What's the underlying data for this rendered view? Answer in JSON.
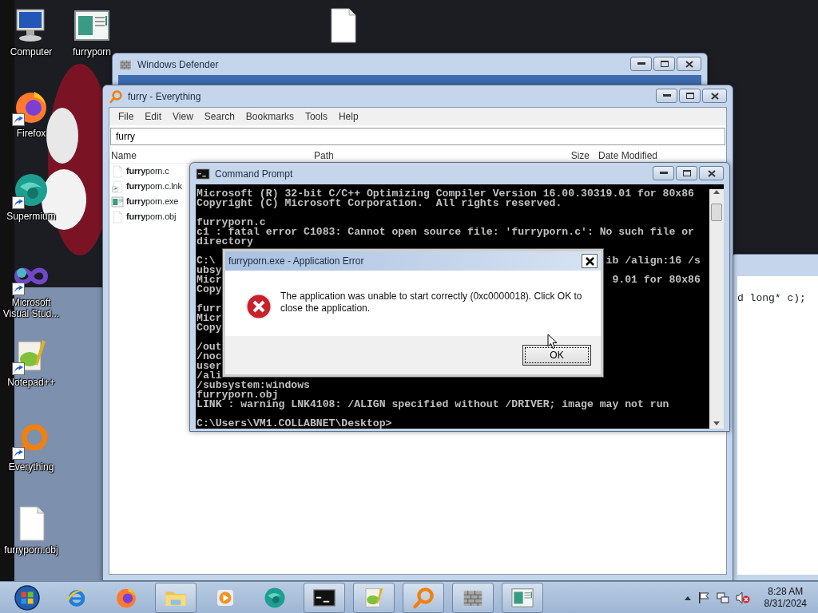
{
  "desktop_icons": [
    {
      "label": "Computer",
      "kind": "computer",
      "shortcut": false
    },
    {
      "label": "furryporn",
      "kind": "program",
      "shortcut": false
    },
    {
      "kind": "file",
      "shortcut": false
    },
    {
      "label": "Firefox",
      "kind": "firefox",
      "shortcut": true
    },
    {
      "label": "Supermium",
      "kind": "supermium",
      "shortcut": true
    },
    {
      "label": "Microsoft Visual Stud...",
      "kind": "visual_studio",
      "shortcut": true
    },
    {
      "label": "Notepad++",
      "kind": "notepad",
      "shortcut": true
    },
    {
      "label": "Everything",
      "kind": "everything",
      "shortcut": true
    },
    {
      "label": "furryporn.obj",
      "kind": "file",
      "shortcut": false
    }
  ],
  "defender_window": {
    "title": "Windows Defender"
  },
  "editor_window": {
    "code_line": "d long* c);"
  },
  "everything_window": {
    "title": "furry - Everything",
    "menu": [
      "File",
      "Edit",
      "View",
      "Search",
      "Bookmarks",
      "Tools",
      "Help"
    ],
    "search": "furry",
    "columns": [
      "Name",
      "Path",
      "Size",
      "Date Modified"
    ],
    "rows": [
      {
        "name": "**furry**porn.c",
        "kind": "file"
      },
      {
        "name": "**furry**porn.c.lnk",
        "kind": "shortcut"
      },
      {
        "name": "**furry**porn.exe",
        "kind": "program"
      },
      {
        "name": "**furry**porn.obj",
        "kind": "file"
      }
    ]
  },
  "cmd_window": {
    "title": "Command Prompt",
    "lines": [
      {
        "kind": "text",
        "text": "Microsoft (R) 32-bit C/C++ Optimizing Compiler Version 16.00.30319.01 for 80x86"
      },
      {
        "kind": "text",
        "text": "Copyright (C) Microsoft Corporation.  All rights reserved."
      },
      {
        "kind": "blank"
      },
      {
        "kind": "text",
        "text": "furryporn.c"
      },
      {
        "kind": "text",
        "text": "c1 : fatal error C1083: Cannot open source file: 'furryporn.c': No such file or"
      },
      {
        "kind": "text",
        "text": "directory"
      },
      {
        "kind": "blank"
      },
      {
        "kind": "split",
        "left": "C:\\",
        "right": "ib /align:16 /s"
      },
      {
        "kind": "split",
        "left": "ubsy"
      },
      {
        "kind": "split",
        "left": "Micr",
        "right": "9.01 for 80x86"
      },
      {
        "kind": "split",
        "left": "Copy"
      },
      {
        "kind": "blank"
      },
      {
        "kind": "split",
        "left": "furr"
      },
      {
        "kind": "split",
        "left": "Micr"
      },
      {
        "kind": "split",
        "left": "Copy"
      },
      {
        "kind": "blank"
      },
      {
        "kind": "split",
        "left": "/out"
      },
      {
        "kind": "split",
        "left": "/noc"
      },
      {
        "kind": "split",
        "left": "user"
      },
      {
        "kind": "split",
        "left": "/ali"
      },
      {
        "kind": "text",
        "text": "/subsystem:windows"
      },
      {
        "kind": "text",
        "text": "furryporn.obj"
      },
      {
        "kind": "text",
        "text": "LINK : warning LNK4108: /ALIGN specified without /DRIVER; image may not run"
      },
      {
        "kind": "blank"
      },
      {
        "kind": "text",
        "text": "C:\\Users\\VM1.COLLABNET\\Desktop>"
      }
    ]
  },
  "error_dialog": {
    "title": "furryporn.exe - Application Error",
    "message": "The application was unable to start correctly (0xc0000018). Click OK to close the application.",
    "button": "OK",
    "focused": true
  },
  "taskbar": {
    "items": [
      {
        "kind": "start",
        "running": false
      },
      {
        "kind": "ie",
        "running": false
      },
      {
        "kind": "firefox",
        "running": false
      },
      {
        "kind": "explorer",
        "running": true
      },
      {
        "kind": "media",
        "running": false
      },
      {
        "kind": "supermium",
        "running": false
      },
      {
        "kind": "cmd",
        "running": true
      },
      {
        "kind": "notepad",
        "running": true
      },
      {
        "kind": "everything",
        "running": true
      },
      {
        "kind": "defender",
        "running": true
      },
      {
        "kind": "program",
        "running": true
      }
    ],
    "time": "8:28 AM",
    "date": "8/31/2024"
  }
}
